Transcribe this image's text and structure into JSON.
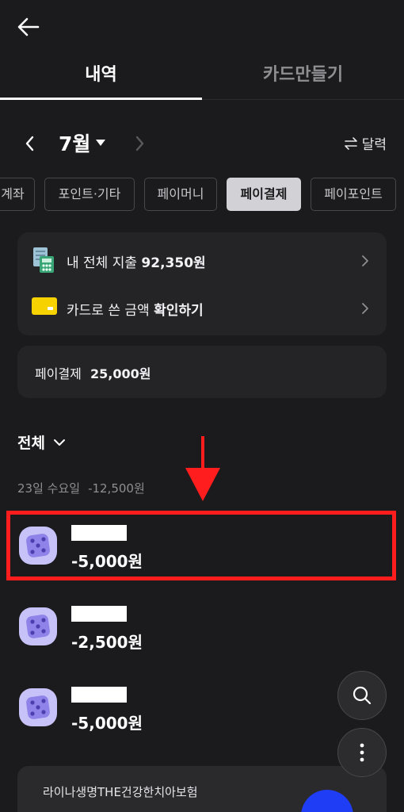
{
  "header": {
    "back_icon": "arrow-left-icon"
  },
  "tabs": [
    {
      "label": "내역",
      "active": true
    },
    {
      "label": "카드만들기",
      "active": false
    }
  ],
  "month_nav": {
    "month": "7월",
    "calendar_label": "달력"
  },
  "chips": [
    {
      "label": "계좌"
    },
    {
      "label": "포인트·기타"
    },
    {
      "label": "페이머니"
    },
    {
      "label": "페이결제",
      "selected": true
    },
    {
      "label": "페이포인트"
    }
  ],
  "summary": {
    "spend_prefix": "내 전체 지출",
    "spend_amount": "92,350원",
    "card_prefix": "카드로 쓴 금액",
    "card_action": "확인하기"
  },
  "pay_total": {
    "label": "페이결제",
    "amount": "25,000원"
  },
  "filter": {
    "label": "전체"
  },
  "date_group": {
    "date": "23일 수요일",
    "total": "-12,500원"
  },
  "transactions": [
    {
      "amount": "-5,000원",
      "icon": "dice-icon",
      "highlighted": true
    },
    {
      "amount": "-2,500원",
      "icon": "dice-icon"
    },
    {
      "amount": "-5,000원",
      "icon": "dice-icon"
    }
  ],
  "promo": {
    "line1": "라이나생명THE건강한치아보험"
  },
  "colors": {
    "background": "#1b1b1d",
    "card": "#242426",
    "highlight": "#ff1d1d",
    "icon_bg": "#c7c2f7",
    "icon_dot": "#7b6cd6"
  }
}
